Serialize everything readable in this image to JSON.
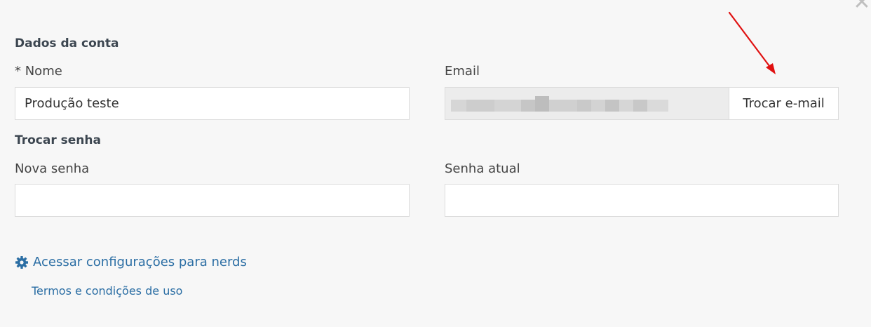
{
  "close": {
    "icon": "close-icon",
    "glyph": "✕"
  },
  "account": {
    "title": "Dados da conta",
    "name_label": "* Nome",
    "name_value": "Produção teste",
    "email_label": "Email",
    "email_value": "",
    "swap_email_button": "Trocar e-mail"
  },
  "password": {
    "title": "Trocar senha",
    "new_label": "Nova senha",
    "new_value": "",
    "current_label": "Senha atual",
    "current_value": ""
  },
  "links": {
    "nerds_icon": "gear-icon",
    "nerds_label": "Acessar configurações para nerds",
    "terms_label": "Termos e condições de uso"
  },
  "colors": {
    "link": "#2b6ea4",
    "annotation_arrow": "#e01010",
    "background": "#f7f7f7"
  }
}
